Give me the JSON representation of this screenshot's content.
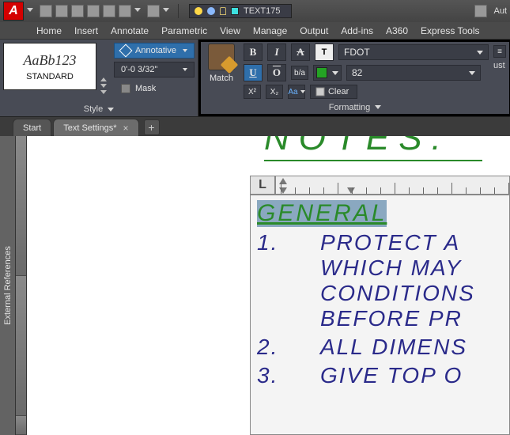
{
  "qat": {
    "layer_name": "TEXT175",
    "right_label": "Aut"
  },
  "ribbon_tabs": [
    "Home",
    "Insert",
    "Annotate",
    "Parametric",
    "View",
    "Manage",
    "Output",
    "Add-ins",
    "A360",
    "Express Tools"
  ],
  "style_panel": {
    "sample": "AaBb123",
    "current": "STANDARD",
    "title": "Style",
    "annotative": "Annotative",
    "height": "0'-0 3/32\"",
    "mask": "Mask"
  },
  "format_panel": {
    "match": "Match",
    "font": "FDOT",
    "size": "82",
    "color_hex": "#24a324",
    "clear": "Clear",
    "title": "Formatting",
    "bg_btn": "T"
  },
  "doc_tabs": {
    "start": "Start",
    "active": "Text Settings*"
  },
  "side_panel": "External References",
  "drawing": {
    "title": "NOTES:",
    "section": "GENERAL",
    "items": [
      {
        "n": "1.",
        "lines": [
          "PROTECT A",
          "WHICH MAY",
          "CONDITIONS",
          "BEFORE PR"
        ]
      },
      {
        "n": "2.",
        "lines": [
          "ALL DIMENS"
        ]
      },
      {
        "n": "3.",
        "lines": [
          "GIVE TOP O"
        ]
      }
    ]
  }
}
